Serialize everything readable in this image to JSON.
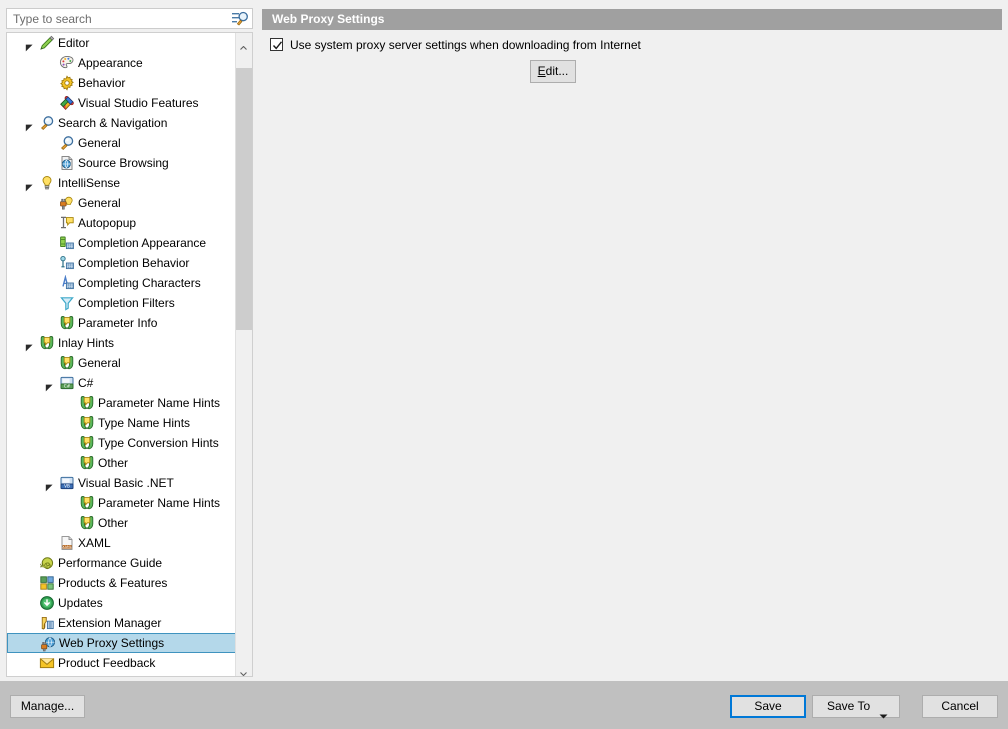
{
  "search": {
    "placeholder": "Type to search",
    "value": "",
    "icon": "search-options-icon"
  },
  "tree": {
    "selected_index": 30,
    "items": [
      {
        "label": "Editor",
        "level": 0,
        "expander": "expanded",
        "icon": "pencil-icon"
      },
      {
        "label": "Appearance",
        "level": 1,
        "expander": "none",
        "icon": "palette-icon"
      },
      {
        "label": "Behavior",
        "level": 1,
        "expander": "none",
        "icon": "gear-icon"
      },
      {
        "label": "Visual Studio Features",
        "level": 1,
        "expander": "none",
        "icon": "puzzle-icon"
      },
      {
        "label": "Search & Navigation",
        "level": 0,
        "expander": "expanded",
        "icon": "magnifier-icon"
      },
      {
        "label": "General",
        "level": 1,
        "expander": "none",
        "icon": "magnifier-icon"
      },
      {
        "label": "Source Browsing",
        "level": 1,
        "expander": "none",
        "icon": "globe-page-icon"
      },
      {
        "label": "IntelliSense",
        "level": 0,
        "expander": "expanded",
        "icon": "lightbulb-icon"
      },
      {
        "label": "General",
        "level": 1,
        "expander": "none",
        "icon": "bulb-plug-icon"
      },
      {
        "label": "Autopopup",
        "level": 1,
        "expander": "none",
        "icon": "caret-tooltip-icon"
      },
      {
        "label": "Completion Appearance",
        "level": 1,
        "expander": "none",
        "icon": "completion-appearance-icon"
      },
      {
        "label": "Completion Behavior",
        "level": 1,
        "expander": "none",
        "icon": "completion-behavior-icon"
      },
      {
        "label": "Completing Characters",
        "level": 1,
        "expander": "none",
        "icon": "completing-characters-icon"
      },
      {
        "label": "Completion Filters",
        "level": 1,
        "expander": "none",
        "icon": "funnel-icon"
      },
      {
        "label": "Parameter Info",
        "level": 1,
        "expander": "none",
        "icon": "inlay-hint-icon"
      },
      {
        "label": "Inlay Hints",
        "level": 0,
        "expander": "expanded",
        "icon": "inlay-hint-icon"
      },
      {
        "label": "General",
        "level": 1,
        "expander": "none",
        "icon": "inlay-hint-icon"
      },
      {
        "label": "C#",
        "level": 1,
        "expander": "expanded",
        "icon": "csharp-icon"
      },
      {
        "label": "Parameter Name Hints",
        "level": 2,
        "expander": "none",
        "icon": "inlay-hint-icon"
      },
      {
        "label": "Type Name Hints",
        "level": 2,
        "expander": "none",
        "icon": "inlay-hint-icon"
      },
      {
        "label": "Type Conversion Hints",
        "level": 2,
        "expander": "none",
        "icon": "inlay-hint-icon"
      },
      {
        "label": "Other",
        "level": 2,
        "expander": "none",
        "icon": "inlay-hint-icon"
      },
      {
        "label": "Visual Basic .NET",
        "level": 1,
        "expander": "expanded",
        "icon": "vb-icon"
      },
      {
        "label": "Parameter Name Hints",
        "level": 2,
        "expander": "none",
        "icon": "inlay-hint-icon"
      },
      {
        "label": "Other",
        "level": 2,
        "expander": "none",
        "icon": "inlay-hint-icon"
      },
      {
        "label": "XAML",
        "level": 1,
        "expander": "none",
        "icon": "xaml-icon"
      },
      {
        "label": "Performance Guide",
        "level": 0,
        "expander": "none",
        "icon": "snail-icon"
      },
      {
        "label": "Products & Features",
        "level": 0,
        "expander": "none",
        "icon": "products-icon"
      },
      {
        "label": "Updates",
        "level": 0,
        "expander": "none",
        "icon": "updates-icon"
      },
      {
        "label": "Extension Manager",
        "level": 0,
        "expander": "none",
        "icon": "extension-icon"
      },
      {
        "label": "Web Proxy Settings",
        "level": 0,
        "expander": "none",
        "icon": "web-proxy-icon"
      },
      {
        "label": "Product Feedback",
        "level": 0,
        "expander": "none",
        "icon": "envelope-icon"
      }
    ]
  },
  "page": {
    "title": "Web Proxy Settings",
    "checkbox": {
      "label": "Use system proxy server settings when downloading from Internet",
      "checked": true
    },
    "edit_button": {
      "accel": "E",
      "rest": "dit..."
    }
  },
  "footer": {
    "manage_label": "Manage...",
    "save_label": "Save",
    "save_to_label": "Save To",
    "cancel_label": "Cancel"
  },
  "colors": {
    "accent_focus": "#0078d7",
    "header_bar": "#a0a0a0",
    "selection_fill": "#b4d8ea",
    "selection_border": "#3f93bf",
    "footer_bg": "#c0c0c0",
    "window_bg": "#f0f0f0"
  }
}
